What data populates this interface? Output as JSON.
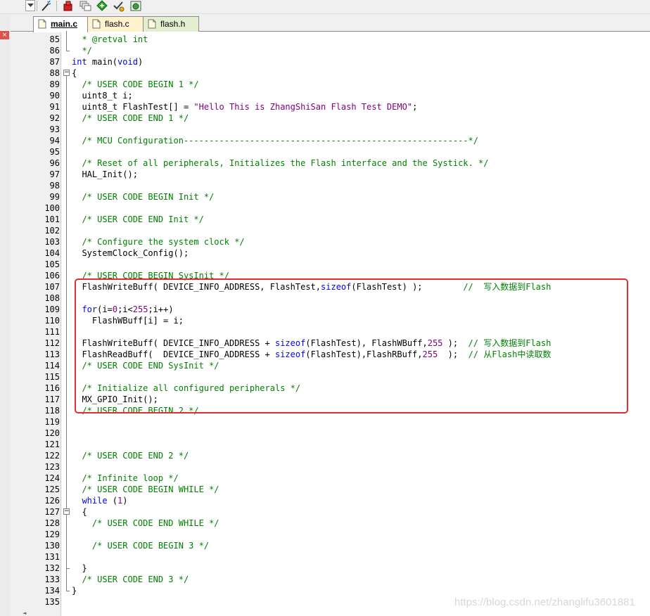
{
  "toolbar": {
    "icons": [
      "dropdown-arrow-icon",
      "wand-icon",
      "red-module-icon",
      "stack-icon",
      "green-diamond-icon",
      "check-tool-icon",
      "green-gear-icon"
    ]
  },
  "left_strip": {
    "close_glyph": "×"
  },
  "tabs": [
    {
      "label": "main.c",
      "active": true
    },
    {
      "label": "flash.c",
      "active": false
    },
    {
      "label": "flash.h",
      "active": false
    }
  ],
  "lines": [
    {
      "n": "85",
      "segs": [
        {
          "t": "  * @retval int",
          "c": "cm"
        }
      ]
    },
    {
      "n": "86",
      "segs": [
        {
          "t": "  */",
          "c": "cm"
        }
      ]
    },
    {
      "n": "87",
      "segs": [
        {
          "t": "int",
          "c": "kw"
        },
        {
          "t": " main("
        },
        {
          "t": "void",
          "c": "kw"
        },
        {
          "t": ")"
        }
      ]
    },
    {
      "n": "88",
      "segs": [
        {
          "t": "{"
        }
      ]
    },
    {
      "n": "89",
      "segs": [
        {
          "t": "  /* USER CODE BEGIN 1 */",
          "c": "cm"
        }
      ]
    },
    {
      "n": "90",
      "segs": [
        {
          "t": "  uint8_t i;"
        }
      ]
    },
    {
      "n": "91",
      "segs": [
        {
          "t": "  uint8_t FlashTest[] = "
        },
        {
          "t": "\"Hello This is ZhangShiSan Flash Test DEMO\"",
          "c": "str"
        },
        {
          "t": ";"
        }
      ]
    },
    {
      "n": "92",
      "segs": [
        {
          "t": "  /* USER CODE END 1 */",
          "c": "cm"
        }
      ]
    },
    {
      "n": "93",
      "segs": []
    },
    {
      "n": "94",
      "segs": [
        {
          "t": "  /* MCU Configuration--------------------------------------------------------*/",
          "c": "cm"
        }
      ]
    },
    {
      "n": "95",
      "segs": []
    },
    {
      "n": "96",
      "segs": [
        {
          "t": "  /* Reset of all peripherals, Initializes the Flash interface and the Systick. */",
          "c": "cm"
        }
      ]
    },
    {
      "n": "97",
      "segs": [
        {
          "t": "  HAL_Init();"
        }
      ]
    },
    {
      "n": "98",
      "segs": []
    },
    {
      "n": "99",
      "segs": [
        {
          "t": "  /* USER CODE BEGIN Init */",
          "c": "cm"
        }
      ]
    },
    {
      "n": "100",
      "segs": []
    },
    {
      "n": "101",
      "segs": [
        {
          "t": "  /* USER CODE END Init */",
          "c": "cm"
        }
      ]
    },
    {
      "n": "102",
      "segs": []
    },
    {
      "n": "103",
      "segs": [
        {
          "t": "  /* Configure the system clock */",
          "c": "cm"
        }
      ]
    },
    {
      "n": "104",
      "segs": [
        {
          "t": "  SystemClock_Config();"
        }
      ]
    },
    {
      "n": "105",
      "segs": []
    },
    {
      "n": "106",
      "segs": [
        {
          "t": "  /* USER CODE BEGIN SysInit */",
          "c": "cm"
        }
      ]
    },
    {
      "n": "107",
      "segs": [
        {
          "t": "  FlashWriteBuff( DEVICE_INFO_ADDRESS, FlashTest,"
        },
        {
          "t": "sizeof",
          "c": "kw"
        },
        {
          "t": "(FlashTest) );        "
        },
        {
          "t": "//  写入数据到Flash",
          "c": "cm"
        }
      ]
    },
    {
      "n": "108",
      "segs": []
    },
    {
      "n": "109",
      "segs": [
        {
          "t": "  "
        },
        {
          "t": "for",
          "c": "kw"
        },
        {
          "t": "(i="
        },
        {
          "t": "0",
          "c": "num"
        },
        {
          "t": ";i<"
        },
        {
          "t": "255",
          "c": "num"
        },
        {
          "t": ";i++)"
        }
      ]
    },
    {
      "n": "110",
      "segs": [
        {
          "t": "    FlashWBuff[i] = i;"
        }
      ]
    },
    {
      "n": "111",
      "segs": []
    },
    {
      "n": "112",
      "segs": [
        {
          "t": "  FlashWriteBuff( DEVICE_INFO_ADDRESS + "
        },
        {
          "t": "sizeof",
          "c": "kw"
        },
        {
          "t": "(FlashTest), FlashWBuff,"
        },
        {
          "t": "255",
          "c": "num"
        },
        {
          "t": " );  "
        },
        {
          "t": "// 写入数据到Flash",
          "c": "cm"
        }
      ]
    },
    {
      "n": "113",
      "segs": [
        {
          "t": "  FlashReadBuff(  DEVICE_INFO_ADDRESS + "
        },
        {
          "t": "sizeof",
          "c": "kw"
        },
        {
          "t": "(FlashTest),FlashRBuff,"
        },
        {
          "t": "255",
          "c": "num"
        },
        {
          "t": "  );  "
        },
        {
          "t": "// 从Flash中读取数",
          "c": "cm"
        }
      ]
    },
    {
      "n": "114",
      "segs": [
        {
          "t": "  /* USER CODE END SysInit */",
          "c": "cm"
        }
      ]
    },
    {
      "n": "115",
      "segs": []
    },
    {
      "n": "116",
      "segs": [
        {
          "t": "  /* Initialize all configured peripherals */",
          "c": "cm"
        }
      ]
    },
    {
      "n": "117",
      "segs": [
        {
          "t": "  MX_GPIO_Init();"
        }
      ]
    },
    {
      "n": "118",
      "segs": [
        {
          "t": "  /* USER CODE BEGIN 2 */",
          "c": "cm"
        }
      ]
    },
    {
      "n": "119",
      "segs": []
    },
    {
      "n": "120",
      "segs": []
    },
    {
      "n": "121",
      "segs": []
    },
    {
      "n": "122",
      "segs": [
        {
          "t": "  /* USER CODE END 2 */",
          "c": "cm"
        }
      ]
    },
    {
      "n": "123",
      "segs": []
    },
    {
      "n": "124",
      "segs": [
        {
          "t": "  /* Infinite loop */",
          "c": "cm"
        }
      ]
    },
    {
      "n": "125",
      "segs": [
        {
          "t": "  /* USER CODE BEGIN WHILE */",
          "c": "cm"
        }
      ]
    },
    {
      "n": "126",
      "segs": [
        {
          "t": "  "
        },
        {
          "t": "while",
          "c": "kw"
        },
        {
          "t": " ("
        },
        {
          "t": "1",
          "c": "num"
        },
        {
          "t": ")"
        }
      ]
    },
    {
      "n": "127",
      "segs": [
        {
          "t": "  {"
        }
      ]
    },
    {
      "n": "128",
      "segs": [
        {
          "t": "    /* USER CODE END WHILE */",
          "c": "cm"
        }
      ]
    },
    {
      "n": "129",
      "segs": []
    },
    {
      "n": "130",
      "segs": [
        {
          "t": "    /* USER CODE BEGIN 3 */",
          "c": "cm"
        }
      ]
    },
    {
      "n": "131",
      "segs": []
    },
    {
      "n": "132",
      "segs": [
        {
          "t": "  }"
        }
      ]
    },
    {
      "n": "133",
      "segs": [
        {
          "t": "  /* USER CODE END 3 */",
          "c": "cm"
        }
      ]
    },
    {
      "n": "134",
      "segs": [
        {
          "t": "}"
        }
      ]
    },
    {
      "n": "135",
      "segs": []
    }
  ],
  "watermark": "https://blog.csdn.net/zhanglifu3601881",
  "colors": {
    "keyword": "#0000ff",
    "comment": "#008000",
    "string": "#800080",
    "highlight": "#e52d2d"
  }
}
